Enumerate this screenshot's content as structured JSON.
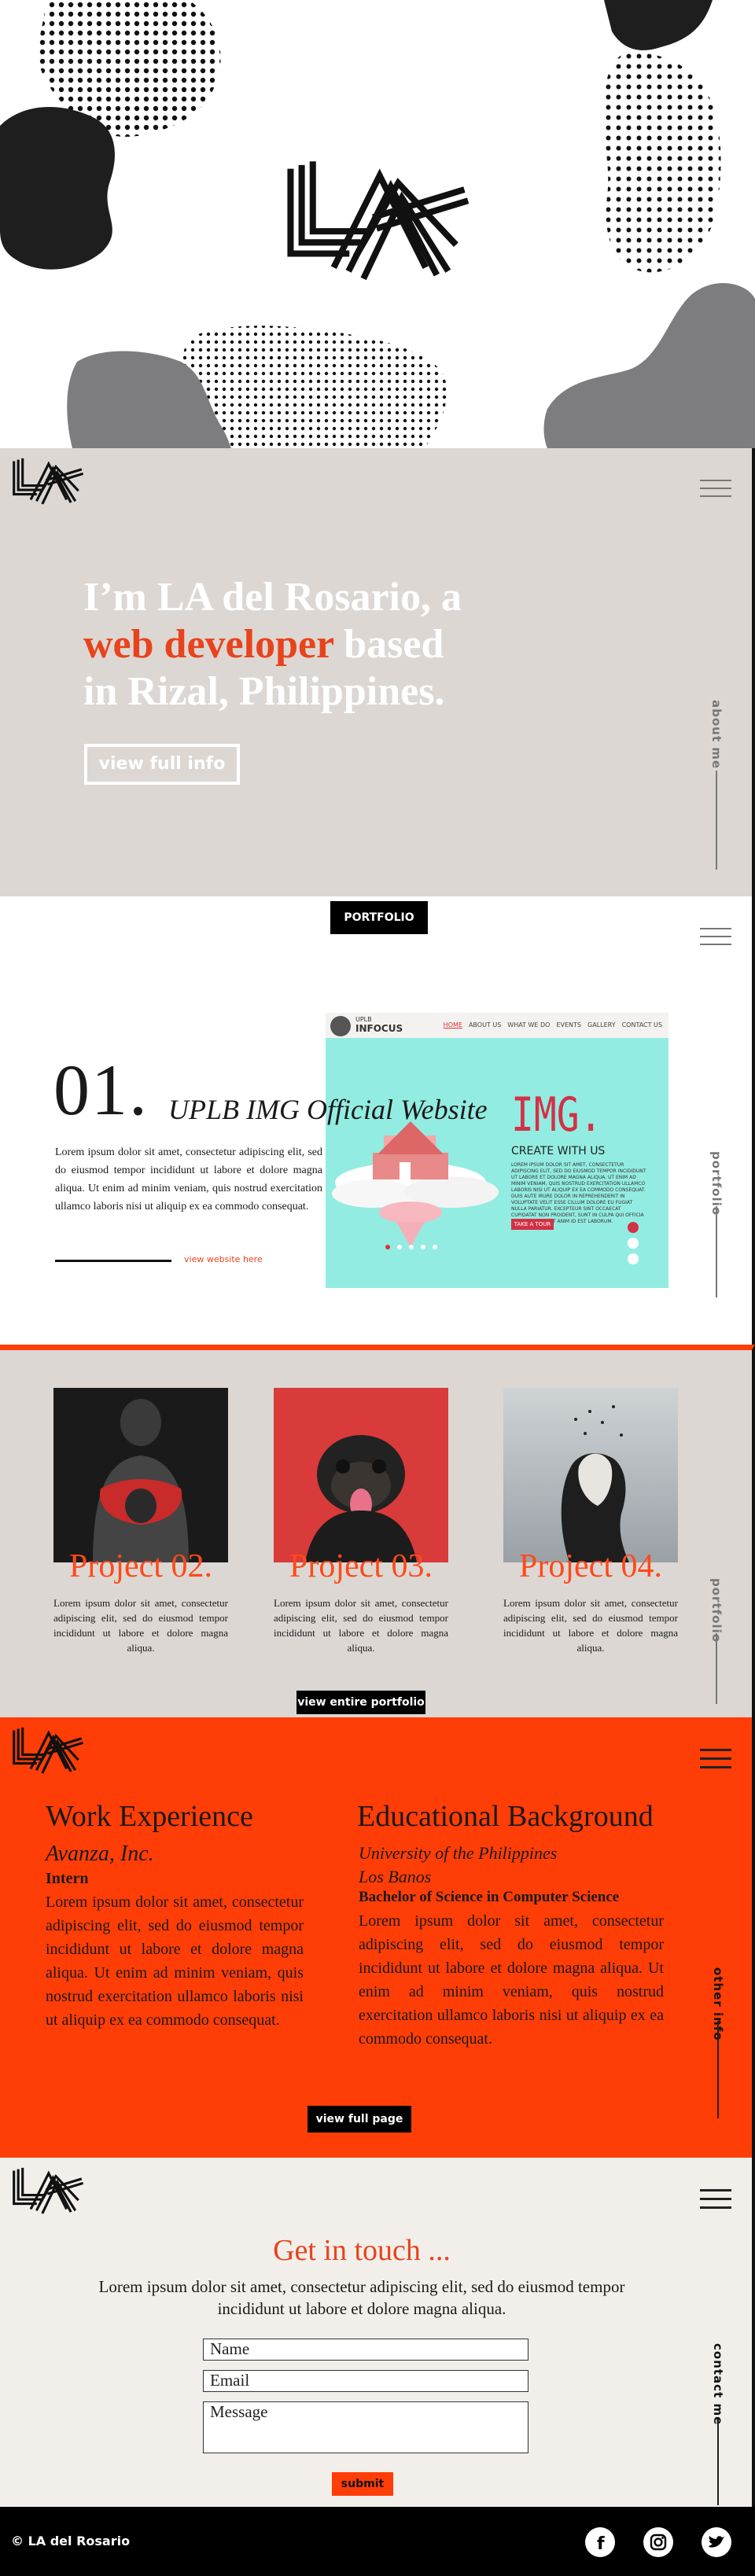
{
  "intro": {
    "line1": "I’m LA del Rosario, a",
    "accent": "web developer",
    "rest": " based",
    "line3": "in Rizal, Philippines.",
    "button": "view full info",
    "side_label": "about me"
  },
  "feature": {
    "tab": "PORTFOLIO",
    "number": "01.",
    "title": "UPLB IMG Official Website",
    "description": "Lorem ipsum dolor sit amet, consectetur adipiscing elit, sed do eiusmod tempor incididunt ut labore et dolore magna aliqua. Ut enim ad minim veniam, quis nostrud exercitation ullamco laboris nisi ut aliquip ex ea commodo consequat.",
    "link": "view website here",
    "side_label": "portfolio",
    "screenshot": {
      "brand_top": "UPLB",
      "brand_name": "INFOCUS",
      "nav": [
        "HOME",
        "ABOUT US",
        "WHAT WE DO",
        "EVENTS",
        "GALLERY",
        "CONTACT US"
      ],
      "headline": "IMG.",
      "subhead": "CREATE WITH US",
      "text": "LOREM IPSUM DOLOR SIT AMET, CONSECTETUR ADIPISCING ELIT, SED DO EIUSMOD TEMPOR INCIDIDUNT UT LABORE ET DOLORE MAGNA ALIQUA. UT ENIM AD MINIM VENIAM, QUIS NOSTRUD EXERCITATION ULLAMCO LABORIS NISI UT ALIQUIP EX EA COMMODO CONSEQUAT. DUIS AUTE IRURE DOLOR IN REPREHENDERIT IN VOLUPTATE VELIT ESSE CILLUM DOLORE EU FUGIAT NULLA PARIATUR. EXCEPTEUR SINT OCCAECAT CUPIDATAT NON PROIDENT, SUNT IN CULPA QUI OFFICIA DESERUNT MOLLIT ANIM ID EST LABORUM.",
      "button": "TAKE A TOUR"
    }
  },
  "projects": {
    "side_label": "portfolio",
    "items": [
      {
        "title": "Project 02.",
        "text": "Lorem ipsum dolor sit amet, consectetur adipiscing elit, sed do eiusmod tempor incididunt ut labore et dolore magna aliqua."
      },
      {
        "title": "Project 03.",
        "text": "Lorem ipsum dolor sit amet, consectetur adipiscing elit, sed do eiusmod tempor incididunt ut labore et dolore magna aliqua."
      },
      {
        "title": "Project 04.",
        "text": "Lorem ipsum dolor sit amet, consectetur adipiscing elit, sed do eiusmod tempor incididunt ut labore et dolore magna aliqua."
      }
    ],
    "button": "view entire portfolio"
  },
  "experience": {
    "work_heading": "Work Experience",
    "company": "Avanza, Inc.",
    "role": "Intern",
    "work_text": "Lorem ipsum dolor sit amet, consectetur adipiscing elit, sed do eiusmod tempor incididunt ut labore et dolore magna aliqua. Ut enim ad minim veniam, quis nostrud exercitation ullamco laboris nisi ut aliquip ex ea commodo consequat.",
    "edu_heading": "Educational Background",
    "school": "University of the Philippines",
    "campus": "Los Banos",
    "degree": "Bachelor of Science in Computer Science",
    "edu_text": "Lorem ipsum dolor sit amet, consectetur adipiscing elit, sed do eiusmod tempor incididunt ut labore et dolore magna aliqua. Ut enim ad minim veniam, quis nostrud exercitation ullamco laboris nisi ut aliquip ex ea commodo consequat.",
    "button": "view full page",
    "side_label": "other info"
  },
  "contact": {
    "title": "Get in touch ...",
    "text": "Lorem ipsum dolor sit amet, consectetur adipiscing elit, sed do eiusmod tempor incididunt ut labore et dolore magna aliqua.",
    "name_placeholder": "Name",
    "email_placeholder": "Email",
    "message_placeholder": "Message",
    "submit": "submit",
    "side_label": "contact me"
  },
  "footer": {
    "copyright": "© LA del Rosario",
    "social": [
      "facebook-icon",
      "instagram-icon",
      "twitter-icon"
    ]
  },
  "colors": {
    "accent": "#ff3d07",
    "beige": "#dcd7d3",
    "cream": "#f2efea"
  }
}
